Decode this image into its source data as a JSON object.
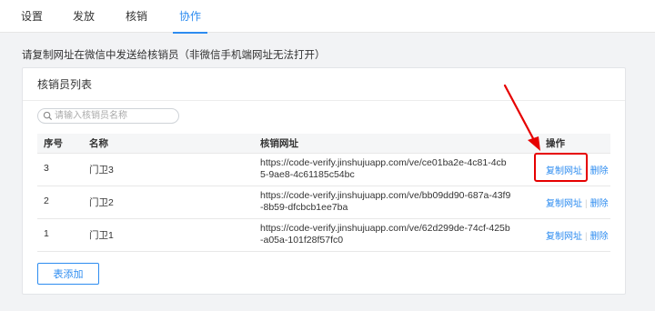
{
  "tabs": [
    {
      "label": "设置"
    },
    {
      "label": "发放"
    },
    {
      "label": "核销"
    },
    {
      "label": "协作"
    }
  ],
  "active_tab": "协作",
  "notice": "请复制网址在微信中发送给核销员（非微信手机端网址无法打开）",
  "card": {
    "title": "核销员列表",
    "search_placeholder": "请输入核销员名称",
    "columns": {
      "no": "序号",
      "name": "名称",
      "url": "核销网址",
      "ops": "操作"
    },
    "rows": [
      {
        "no": "3",
        "name": "门卫3",
        "url": "https://code-verify.jinshujuapp.com/ve/ce01ba2e-4c81-4cb5-9ae8-4c61185c54bc",
        "copy": "复制网址",
        "delete": "删除"
      },
      {
        "no": "2",
        "name": "门卫2",
        "url": "https://code-verify.jinshujuapp.com/ve/bb09dd90-687a-43f9-8b59-dfcbcb1ee7ba",
        "copy": "复制网址",
        "delete": "删除"
      },
      {
        "no": "1",
        "name": "门卫1",
        "url": "https://code-verify.jinshujuapp.com/ve/62d299de-74cf-425b-a05a-101f28f57fc0",
        "copy": "复制网址",
        "delete": "删除"
      }
    ],
    "add_button": "表添加"
  },
  "colors": {
    "accent": "#2d8cf0",
    "annotation": "#e60000"
  }
}
